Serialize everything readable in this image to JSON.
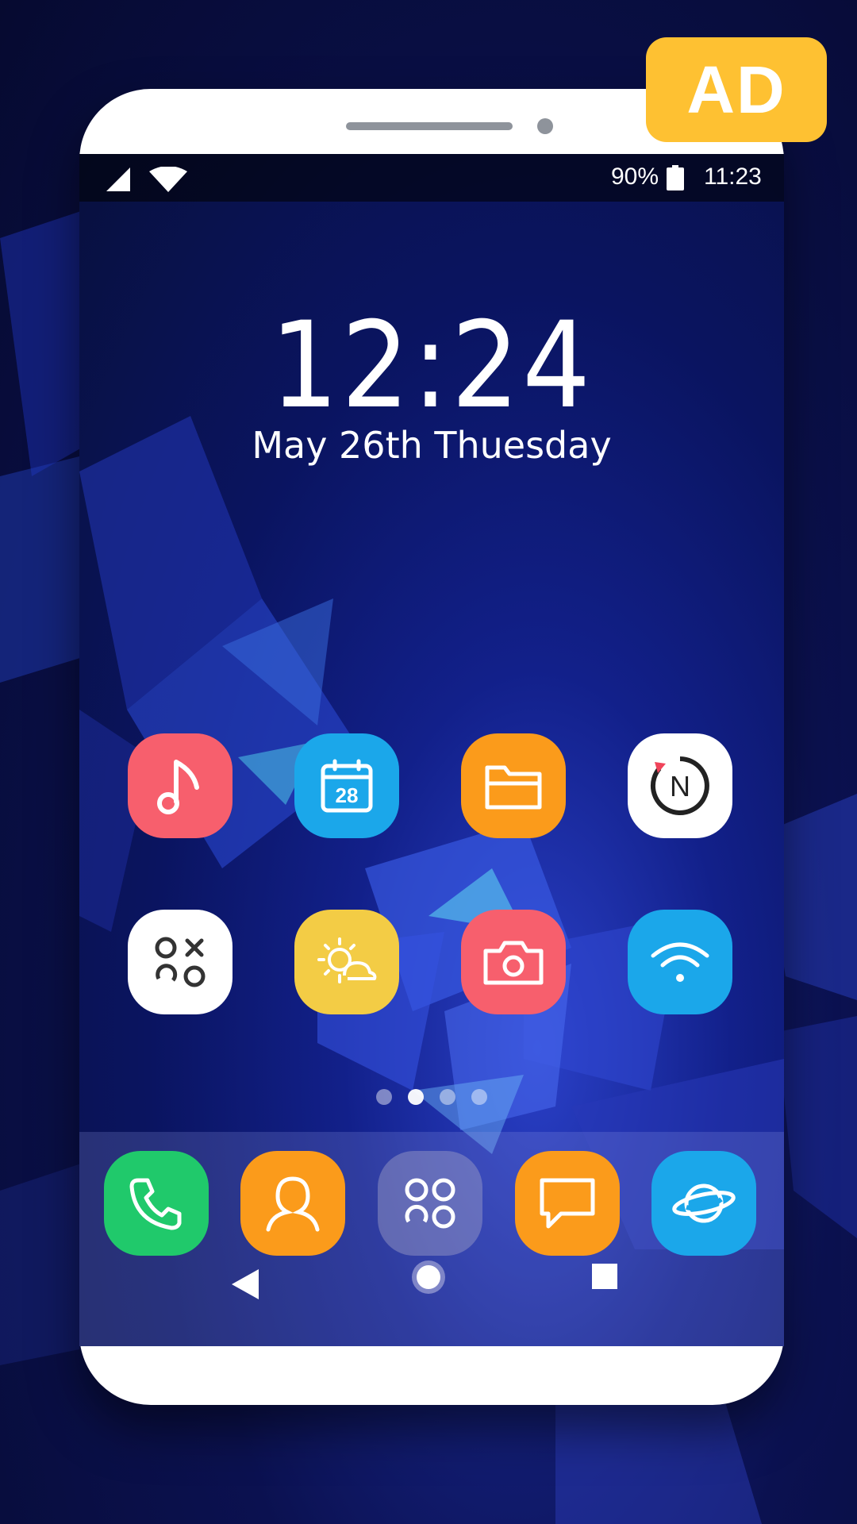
{
  "ad_badge": {
    "label": "AD",
    "color": "#fec132"
  },
  "status_bar": {
    "battery_percent": "90%",
    "time": "11:23",
    "icons": [
      "cell-signal-icon",
      "wifi-icon",
      "battery-icon"
    ]
  },
  "lock_widget": {
    "time": "12:24",
    "date": "May 26th Thuesday"
  },
  "home_apps": [
    {
      "icon": "music-note-icon",
      "color": "#f75f6d"
    },
    {
      "icon": "calendar-icon",
      "color": "#1ba7ea",
      "badge": "28"
    },
    {
      "icon": "folder-icon",
      "color": "#fb9b1b"
    },
    {
      "icon": "news-n-icon",
      "color": "#ffffff"
    },
    {
      "icon": "games-ox-icon",
      "color": "#ffffff"
    },
    {
      "icon": "weather-sun-cloud-icon",
      "color": "#f3cc45"
    },
    {
      "icon": "camera-icon",
      "color": "#f75f6d"
    },
    {
      "icon": "wifi-icon",
      "color": "#1ba7ea"
    }
  ],
  "page_indicator": {
    "count": 4,
    "active_index": 1
  },
  "dock_apps": [
    {
      "icon": "phone-icon",
      "color": "#20c96b"
    },
    {
      "icon": "contacts-icon",
      "color": "#fb9b1b"
    },
    {
      "icon": "app-drawer-icon",
      "color": "rgba(160,160,200,0.45)"
    },
    {
      "icon": "messages-icon",
      "color": "#fb9b1b"
    },
    {
      "icon": "internet-planet-icon",
      "color": "#1ba7ea"
    }
  ],
  "nav_bar": {
    "icons": [
      "back-icon",
      "home-icon",
      "recents-icon"
    ]
  }
}
